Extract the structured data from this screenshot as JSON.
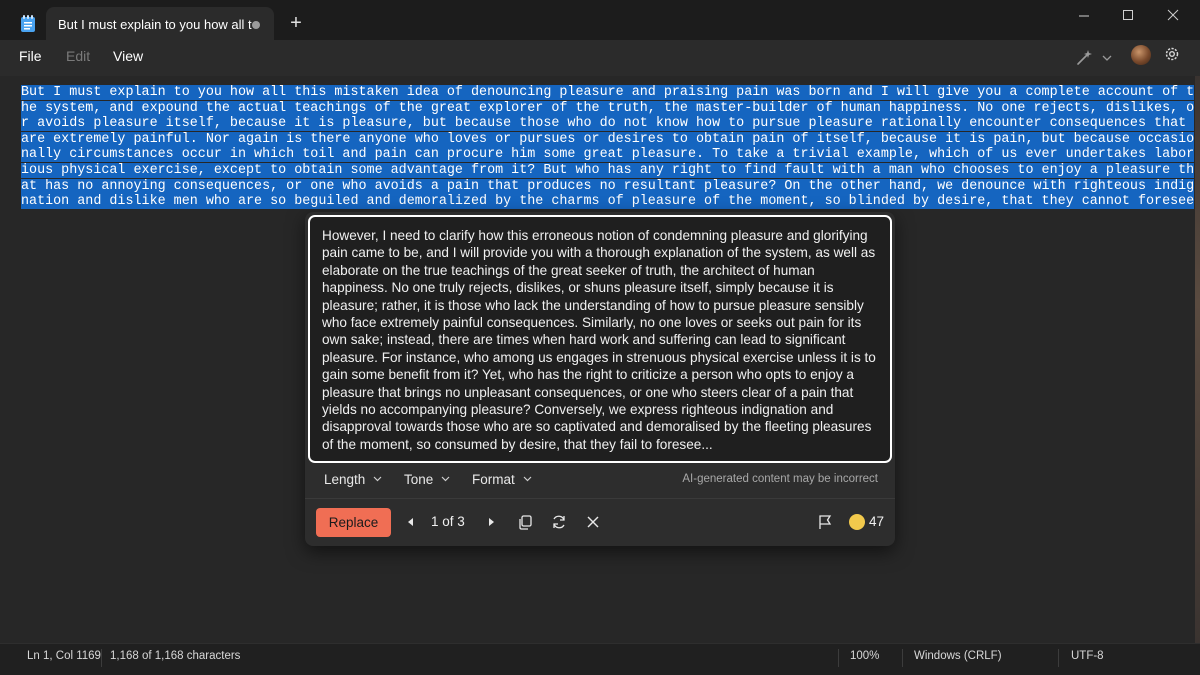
{
  "window": {
    "tab_title": "But I must explain to you how all t",
    "menu": {
      "file": "File",
      "edit": "Edit",
      "view": "View"
    }
  },
  "editor": {
    "selected_text": "But I must explain to you how all this mistaken idea of denouncing pleasure and praising pain was born and I will give you a complete account of the system, and expound the actual teachings of the great explorer of the truth, the master-builder of human happiness. No one rejects, dislikes, or avoids pleasure itself, because it is pleasure, but because those who do not know how to pursue pleasure rationally encounter consequences that are extremely painful. Nor again is there anyone who loves or pursues or desires to obtain pain of itself, because it is pain, but because occasionally circumstances occur in which toil and pain can procure him some great pleasure. To take a trivial example, which of us ever undertakes laborious physical exercise, except to obtain some advantage from it? But who has any right to find fault with a man who chooses to enjoy a pleasure that has no annoying consequences, or one who avoids a pain that produces no resultant pleasure? On the other hand, we denounce with righteous indignation and dislike men who are so beguiled and demoralized by the charms of pleasure of the moment, so blinded by desire, that they cannot foresee"
  },
  "rewrite": {
    "suggestion": "However, I need to clarify how this erroneous notion of condemning pleasure and glorifying pain came to be, and I will provide you with a thorough explanation of the system, as well as elaborate on the true teachings of the great seeker of truth, the architect of human happiness. No one truly rejects, dislikes, or shuns pleasure itself, simply because it is pleasure; rather, it is those who lack the understanding of how to pursue pleasure sensibly who face extremely painful consequences. Similarly, no one loves or seeks out pain for its own sake; instead, there are times when hard work and suffering can lead to significant pleasure. For instance, who among us engages in strenuous physical exercise unless it is to gain some benefit from it? Yet, who has the right to criticize a person who opts to enjoy a pleasure that brings no unpleasant consequences, or one who steers clear of a pain that yields no accompanying pleasure? Conversely, we express righteous indignation and disapproval towards those who are so captivated and demoralised by the fleeting pleasures of the moment, so consumed by desire, that they fail to foresee...",
    "options": {
      "length": "Length",
      "tone": "Tone",
      "format": "Format"
    },
    "disclaimer": "AI-generated content may be incorrect",
    "replace_label": "Replace",
    "pager": "1 of 3",
    "credits": "47"
  },
  "status": {
    "position": "Ln 1, Col 1169",
    "characters": "1,168 of 1,168 characters",
    "zoom": "100%",
    "line_ending": "Windows (CRLF)",
    "encoding": "UTF-8"
  },
  "colors": {
    "selection": "#1565c0",
    "replace_button": "#f06e54",
    "credits_coin": "#f2c94c"
  }
}
